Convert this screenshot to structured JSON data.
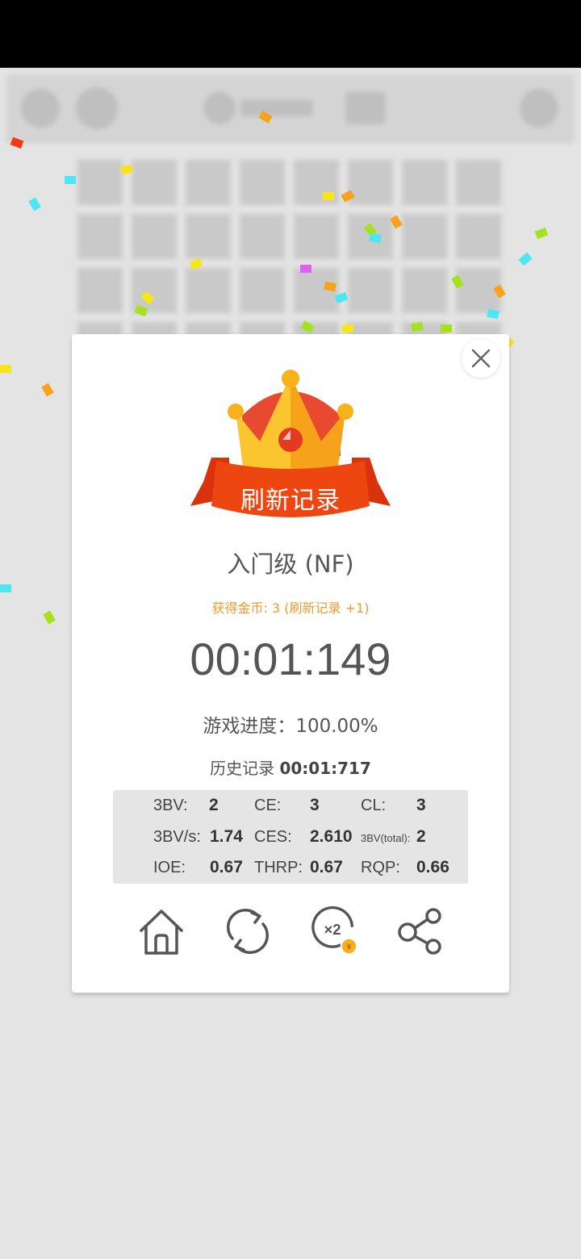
{
  "dialog": {
    "banner_text": "刷新记录",
    "level_title": "入门级 (NF)",
    "coins_text": "获得金币: 3 (刷新记录 +1)",
    "time": "00:01:149",
    "progress_text": "游戏进度：100.00%",
    "history_label": "历史记录",
    "history_value": "00:01:717"
  },
  "stats": {
    "bv_label": "3BV:",
    "bv_value": "2",
    "ce_label": "CE:",
    "ce_value": "3",
    "cl_label": "CL:",
    "cl_value": "3",
    "bvs_label": "3BV/s:",
    "bvs_value": "1.74",
    "ces_label": "CES:",
    "ces_value": "2.610",
    "bvtotal_label": "3BV(total):",
    "bvtotal_value": "2",
    "ioe_label": "IOE:",
    "ioe_value": "0.67",
    "thrp_label": "THRP:",
    "thrp_value": "0.67",
    "rqp_label": "RQP:",
    "rqp_value": "0.66"
  },
  "actions": [
    {
      "icon": "home-icon"
    },
    {
      "icon": "restart-icon"
    },
    {
      "icon": "double-coins-icon",
      "badge": "¥",
      "label": "×2"
    },
    {
      "icon": "share-icon"
    }
  ],
  "colors": {
    "accent_orange": "#f39a2c",
    "banner_red": "#e8400c",
    "crown_gold": "#f9b928"
  }
}
